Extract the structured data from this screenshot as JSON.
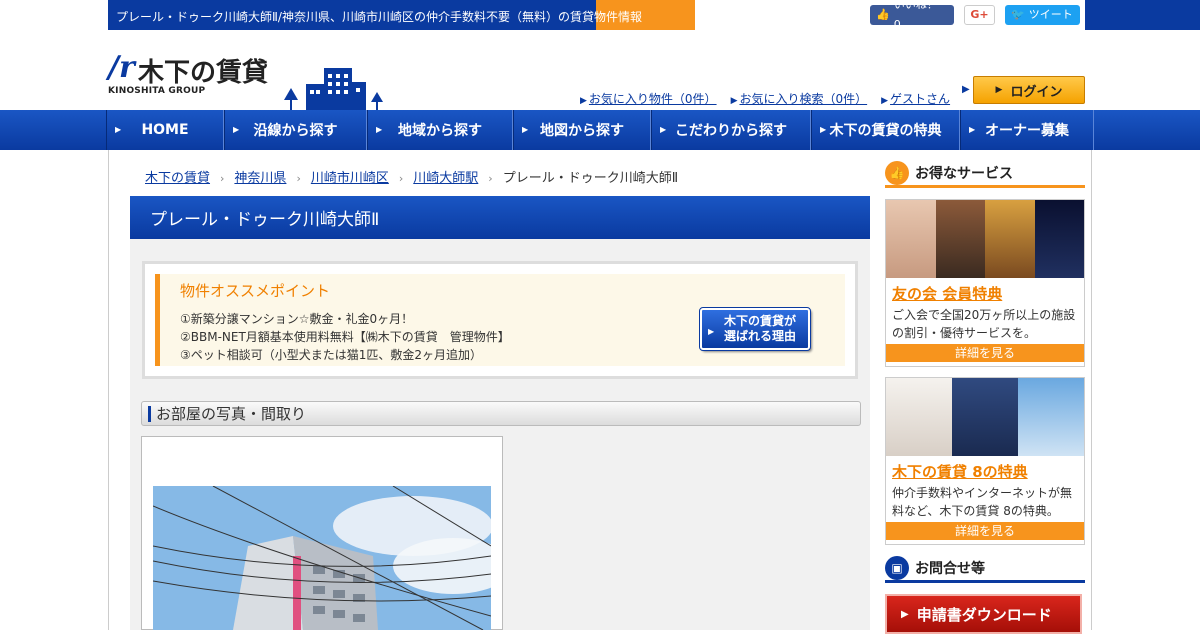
{
  "topbar": {
    "title": "プレール・ドゥーク川崎大師Ⅱ/神奈川県、川崎市川崎区の仲介手数料不要（無料）の賃貸物件情報",
    "fb_like": "いいね！ 0",
    "gplus": "G+",
    "tweet": "ツイート"
  },
  "header": {
    "logo_mark": "/r",
    "logo_name": "木下の賃貸",
    "logo_sub": "KINOSHITA GROUP",
    "links": [
      "お気に入り物件（0件）",
      "お気に入り検索（0件）",
      "ゲストさん"
    ],
    "login": "ログイン"
  },
  "nav": {
    "items": [
      "HOME",
      "沿線から探す",
      "地域から探す",
      "地図から探す",
      "こだわりから探す",
      "木下の賃貸の特典",
      "オーナー募集"
    ]
  },
  "breadcrumb": {
    "items": [
      "木下の賃貸",
      "神奈川県",
      "川崎市川崎区",
      "川崎大師駅"
    ],
    "current": "プレール・ドゥーク川崎大師Ⅱ",
    "separator": "›"
  },
  "property": {
    "title": "プレール・ドゥーク川崎大師Ⅱ",
    "recommend_title": "物件オススメポイント",
    "points": [
      "①新築分譲マンション☆敷金・礼金0ヶ月！",
      "②BBM-NET月額基本使用料無料【㈱木下の賃貸　管理物件】",
      "③ペット相談可（小型犬または猫1匹、敷金2ヶ月追加）"
    ],
    "reason_line1": "木下の賃貸が",
    "reason_line2": "選ばれる理由",
    "photos_heading": "お部屋の写真・間取り"
  },
  "sidebar": {
    "services_heading": "お得なサービス",
    "card1": {
      "title": "友の会 会員特典",
      "desc": "ご入会で全国20万ヶ所以上の施設の割引・優待サービスを。",
      "more": "詳細を見る"
    },
    "card2": {
      "title": "木下の賃貸 8の特典",
      "desc": "仲介手数料やインターネットが無料など、木下の賃貸 8の特典。",
      "more": "詳細を見る"
    },
    "contact_heading": "お問合せ等",
    "download": "申請書ダウンロード"
  },
  "colors": {
    "brand_blue": "#0a3aa0",
    "accent_orange": "#f7941d"
  }
}
